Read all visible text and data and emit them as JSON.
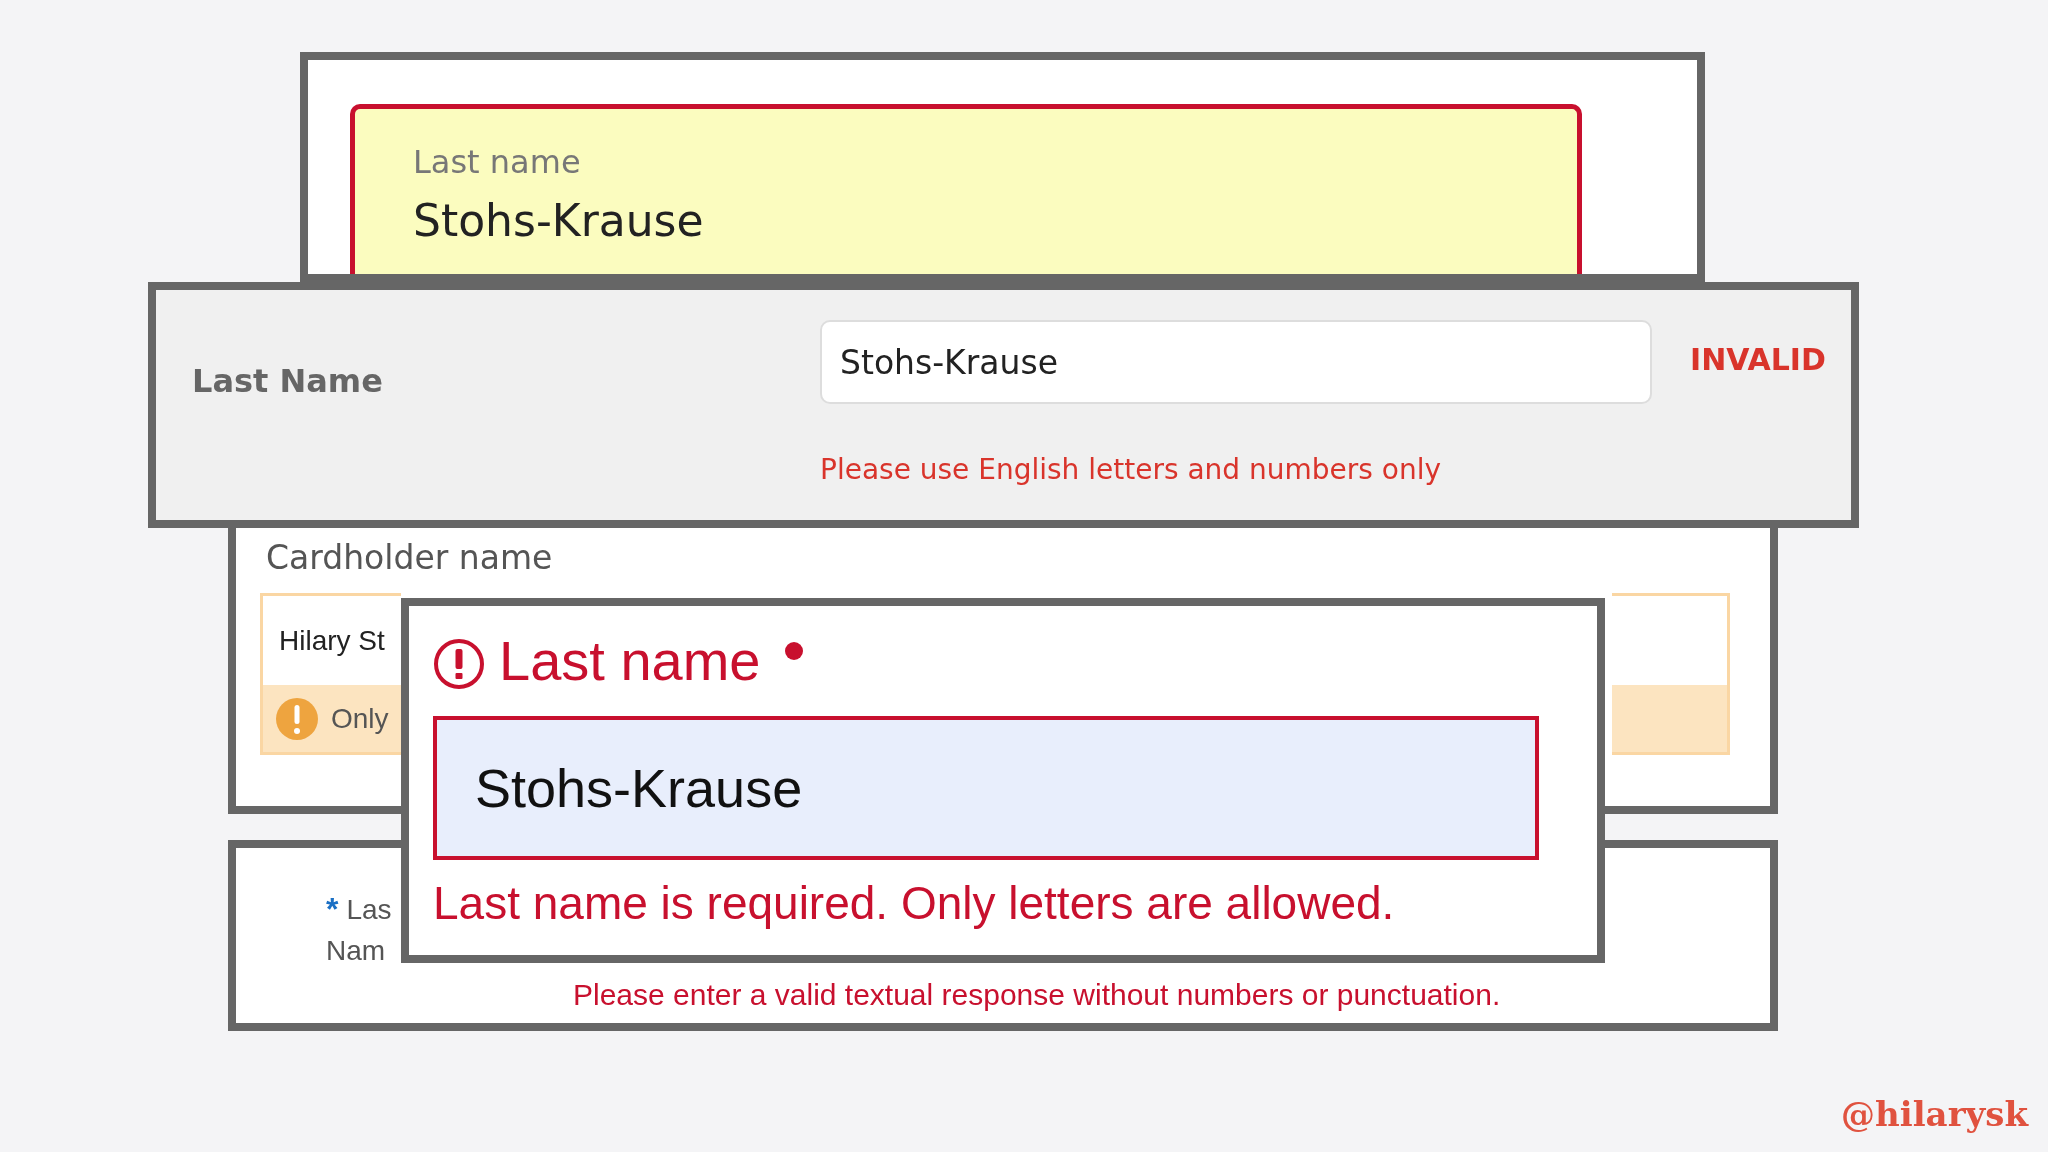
{
  "panels": [
    {
      "kind": "floating",
      "label": "Last name",
      "value": "Stohs-Krause"
    },
    {
      "kind": "inline",
      "label": "Last Name",
      "value": "Stohs-Krause",
      "status": "INVALID",
      "error": "Please use English letters and numbers only"
    },
    {
      "kind": "warning",
      "label": "Cardholder name",
      "value": "Hilary St",
      "warning": "Only"
    },
    {
      "kind": "asterisk",
      "mark": "*",
      "label_lines": [
        "Las",
        "Nam"
      ],
      "error": "Please enter a valid textual response without numbers or punctuation."
    },
    {
      "kind": "heading",
      "label": "Last name",
      "required": true,
      "value": "Stohs-Krause",
      "error": "Last name is required. Only letters are allowed."
    }
  ],
  "credit": "@hilarysk"
}
